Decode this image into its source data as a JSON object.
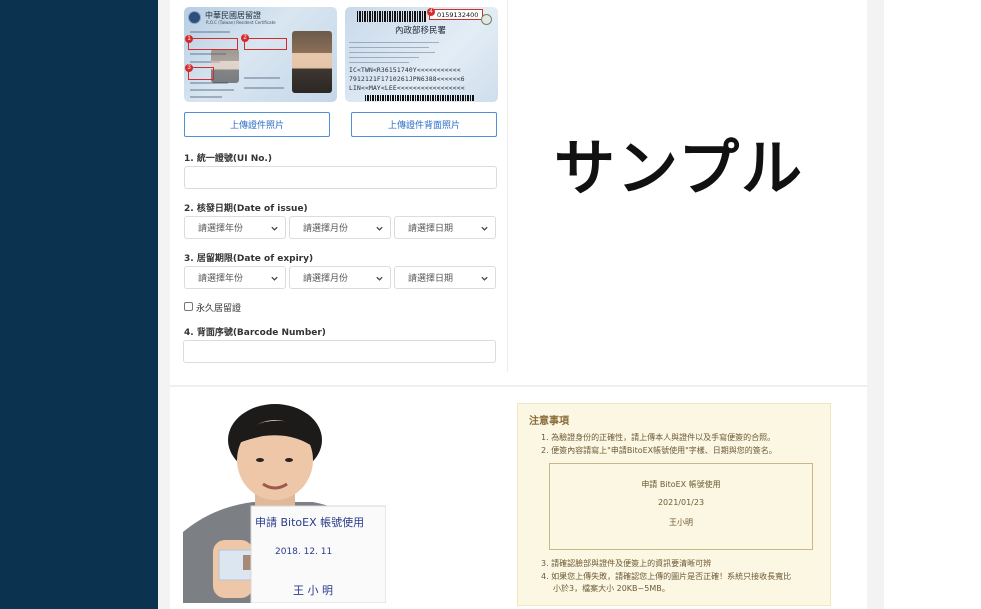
{
  "id_front": {
    "title": "中華民國居留證",
    "subtitle": "R.O.C (Taiwan) Resident Certificate",
    "marker_1": "1",
    "marker_2": "2",
    "marker_3": "3"
  },
  "id_back": {
    "agency": "內政部移民署",
    "number": "0159132400",
    "marker_4": "4",
    "mrz_1": "IC<TWN<R36151740Y<<<<<<<<<<<",
    "mrz_2": "7912121F1710261JPN6388<<<<<<6",
    "mrz_3": "LIN<<MAY<LEE<<<<<<<<<<<<<<<<<"
  },
  "buttons": {
    "upload_front": "上傳證件照片",
    "upload_back": "上傳證件背面照片"
  },
  "form": {
    "ui_no_label": "1. 統一證號(UI No.)",
    "issue_label": "2. 核發日期(Date of issue)",
    "expiry_label": "3. 居留期限(Date of expiry)",
    "select_year": "請選擇年份",
    "select_month": "請選擇月份",
    "select_day": "請選擇日期",
    "permanent_label": "永久居留證",
    "barcode_label": "4. 背面序號(Barcode Number)"
  },
  "sample_label": "サンプル",
  "selfie": {
    "line1": "申請 BitoEX 帳號使用",
    "line2": "2018. 12. 11",
    "line3": "王 小 明"
  },
  "notice": {
    "title": "注意事項",
    "item1": "1. 為驗證身份的正確性，請上傳本人與證件以及手寫便簽的合照。",
    "item2": "2. 便簽內容請寫上\"申請BitoEX帳號使用\"字樣、日期與您的簽名。",
    "sig_line1": "申請 BitoEX 帳號使用",
    "sig_line2": "2021/01/23",
    "sig_line3": "王小明",
    "item3": "3. 請確認臉部與證件及便簽上的資訊要清晰可辨",
    "item4a": "4. 如果您上傳失敗，請確認您上傳的圖片是否正確！系統只接收長寬比",
    "item4b": "小於3，檔案大小 20KB~5MB。"
  },
  "colors": {
    "sidebar": "#0b3350",
    "button_border": "#4f8fd8",
    "notice_bg": "#fcf7e3",
    "marker_red": "#d62b2b"
  }
}
